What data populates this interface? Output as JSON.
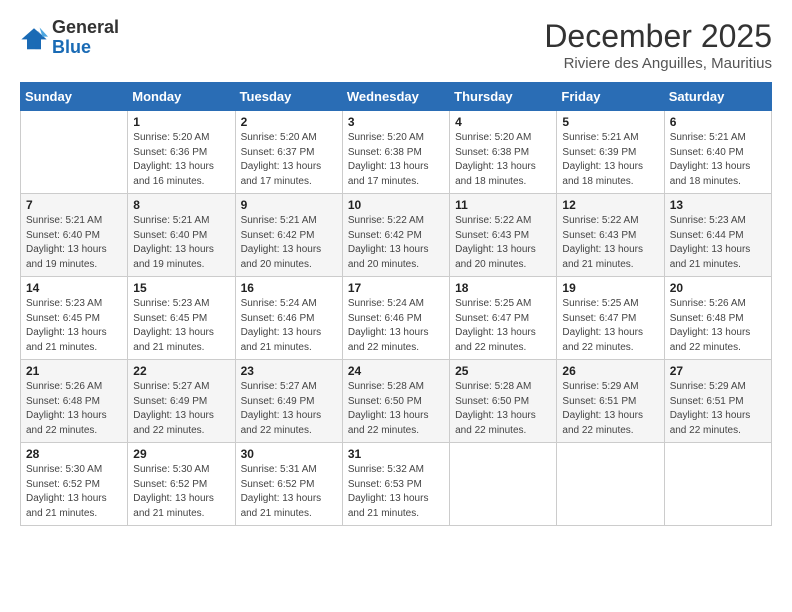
{
  "logo": {
    "general": "General",
    "blue": "Blue"
  },
  "title": "December 2025",
  "subtitle": "Riviere des Anguilles, Mauritius",
  "days_of_week": [
    "Sunday",
    "Monday",
    "Tuesday",
    "Wednesday",
    "Thursday",
    "Friday",
    "Saturday"
  ],
  "weeks": [
    [
      {
        "day": "",
        "info": ""
      },
      {
        "day": "1",
        "info": "Sunrise: 5:20 AM\nSunset: 6:36 PM\nDaylight: 13 hours\nand 16 minutes."
      },
      {
        "day": "2",
        "info": "Sunrise: 5:20 AM\nSunset: 6:37 PM\nDaylight: 13 hours\nand 17 minutes."
      },
      {
        "day": "3",
        "info": "Sunrise: 5:20 AM\nSunset: 6:38 PM\nDaylight: 13 hours\nand 17 minutes."
      },
      {
        "day": "4",
        "info": "Sunrise: 5:20 AM\nSunset: 6:38 PM\nDaylight: 13 hours\nand 18 minutes."
      },
      {
        "day": "5",
        "info": "Sunrise: 5:21 AM\nSunset: 6:39 PM\nDaylight: 13 hours\nand 18 minutes."
      },
      {
        "day": "6",
        "info": "Sunrise: 5:21 AM\nSunset: 6:40 PM\nDaylight: 13 hours\nand 18 minutes."
      }
    ],
    [
      {
        "day": "7",
        "info": ""
      },
      {
        "day": "8",
        "info": "Sunrise: 5:21 AM\nSunset: 6:40 PM\nDaylight: 13 hours\nand 19 minutes."
      },
      {
        "day": "9",
        "info": "Sunrise: 5:21 AM\nSunset: 6:42 PM\nDaylight: 13 hours\nand 20 minutes."
      },
      {
        "day": "10",
        "info": "Sunrise: 5:22 AM\nSunset: 6:42 PM\nDaylight: 13 hours\nand 20 minutes."
      },
      {
        "day": "11",
        "info": "Sunrise: 5:22 AM\nSunset: 6:43 PM\nDaylight: 13 hours\nand 20 minutes."
      },
      {
        "day": "12",
        "info": "Sunrise: 5:22 AM\nSunset: 6:43 PM\nDaylight: 13 hours\nand 21 minutes."
      },
      {
        "day": "13",
        "info": "Sunrise: 5:23 AM\nSunset: 6:44 PM\nDaylight: 13 hours\nand 21 minutes."
      }
    ],
    [
      {
        "day": "14",
        "info": ""
      },
      {
        "day": "15",
        "info": "Sunrise: 5:23 AM\nSunset: 6:45 PM\nDaylight: 13 hours\nand 21 minutes."
      },
      {
        "day": "16",
        "info": "Sunrise: 5:24 AM\nSunset: 6:46 PM\nDaylight: 13 hours\nand 21 minutes."
      },
      {
        "day": "17",
        "info": "Sunrise: 5:24 AM\nSunset: 6:46 PM\nDaylight: 13 hours\nand 22 minutes."
      },
      {
        "day": "18",
        "info": "Sunrise: 5:25 AM\nSunset: 6:47 PM\nDaylight: 13 hours\nand 22 minutes."
      },
      {
        "day": "19",
        "info": "Sunrise: 5:25 AM\nSunset: 6:47 PM\nDaylight: 13 hours\nand 22 minutes."
      },
      {
        "day": "20",
        "info": "Sunrise: 5:26 AM\nSunset: 6:48 PM\nDaylight: 13 hours\nand 22 minutes."
      }
    ],
    [
      {
        "day": "21",
        "info": ""
      },
      {
        "day": "22",
        "info": "Sunrise: 5:27 AM\nSunset: 6:49 PM\nDaylight: 13 hours\nand 22 minutes."
      },
      {
        "day": "23",
        "info": "Sunrise: 5:27 AM\nSunset: 6:49 PM\nDaylight: 13 hours\nand 22 minutes."
      },
      {
        "day": "24",
        "info": "Sunrise: 5:28 AM\nSunset: 6:50 PM\nDaylight: 13 hours\nand 22 minutes."
      },
      {
        "day": "25",
        "info": "Sunrise: 5:28 AM\nSunset: 6:50 PM\nDaylight: 13 hours\nand 22 minutes."
      },
      {
        "day": "26",
        "info": "Sunrise: 5:29 AM\nSunset: 6:51 PM\nDaylight: 13 hours\nand 22 minutes."
      },
      {
        "day": "27",
        "info": "Sunrise: 5:29 AM\nSunset: 6:51 PM\nDaylight: 13 hours\nand 22 minutes."
      }
    ],
    [
      {
        "day": "28",
        "info": "Sunrise: 5:30 AM\nSunset: 6:52 PM\nDaylight: 13 hours\nand 21 minutes."
      },
      {
        "day": "29",
        "info": "Sunrise: 5:30 AM\nSunset: 6:52 PM\nDaylight: 13 hours\nand 21 minutes."
      },
      {
        "day": "30",
        "info": "Sunrise: 5:31 AM\nSunset: 6:52 PM\nDaylight: 13 hours\nand 21 minutes."
      },
      {
        "day": "31",
        "info": "Sunrise: 5:32 AM\nSunset: 6:53 PM\nDaylight: 13 hours\nand 21 minutes."
      },
      {
        "day": "",
        "info": ""
      },
      {
        "day": "",
        "info": ""
      },
      {
        "day": "",
        "info": ""
      }
    ]
  ]
}
